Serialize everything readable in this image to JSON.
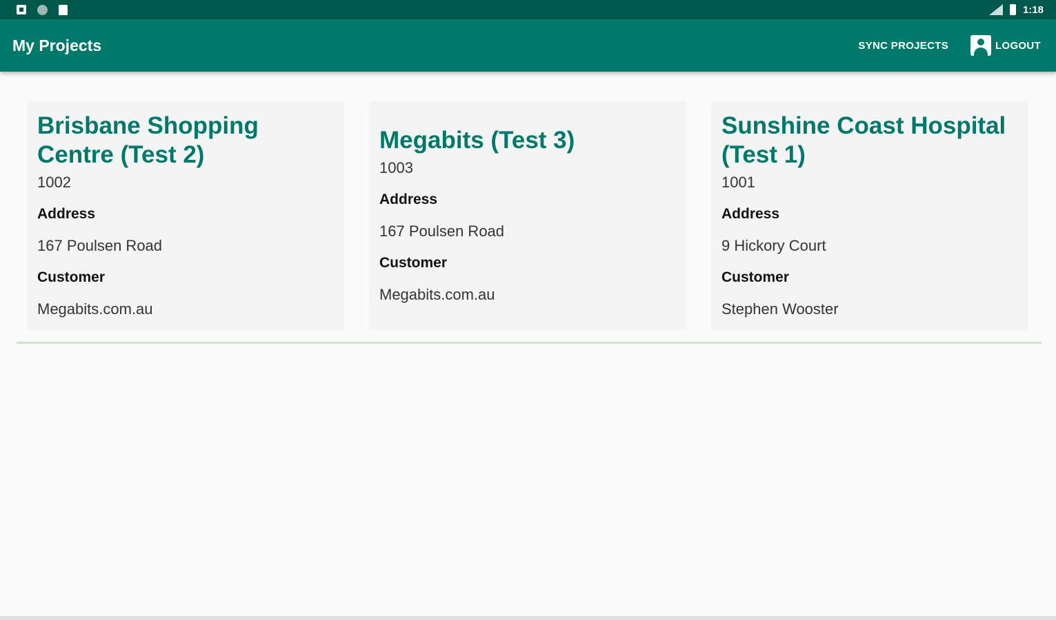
{
  "status_bar": {
    "time": "1:18",
    "left_icons": [
      "notification-square-icon",
      "circle-icon",
      "clipboard-icon"
    ],
    "right_icons": [
      "signal-icon",
      "battery-icon"
    ]
  },
  "app_bar": {
    "title": "My Projects",
    "sync_label": "SYNC PROJECTS",
    "logout_label": "LOGOUT",
    "color": "#00796b"
  },
  "projects": [
    {
      "title": "Brisbane Shopping Centre (Test 2)",
      "code": "1002",
      "address_label": "Address",
      "address": "167 Poulsen Road",
      "customer_label": "Customer",
      "customer": "Megabits.com.au"
    },
    {
      "title": "Megabits (Test 3)",
      "code": "1003",
      "address_label": "Address",
      "address": "167 Poulsen Road",
      "customer_label": "Customer",
      "customer": "Megabits.com.au"
    },
    {
      "title": "Sunshine Coast Hospital (Test 1)",
      "code": "1001",
      "address_label": "Address",
      "address": "9 Hickory Court",
      "customer_label": "Customer",
      "customer": "Stephen Wooster"
    }
  ]
}
